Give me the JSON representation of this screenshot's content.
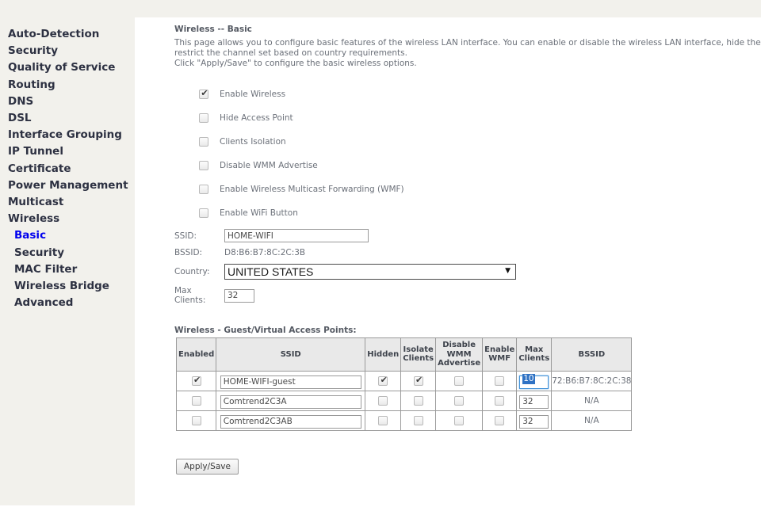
{
  "sidebar": {
    "items": [
      {
        "label": "Auto-Detection",
        "sub": false,
        "active": false
      },
      {
        "label": "Security",
        "sub": false,
        "active": false
      },
      {
        "label": "Quality of Service",
        "sub": false,
        "active": false
      },
      {
        "label": "Routing",
        "sub": false,
        "active": false
      },
      {
        "label": "DNS",
        "sub": false,
        "active": false
      },
      {
        "label": "DSL",
        "sub": false,
        "active": false
      },
      {
        "label": "Interface Grouping",
        "sub": false,
        "active": false
      },
      {
        "label": "IP Tunnel",
        "sub": false,
        "active": false
      },
      {
        "label": "Certificate",
        "sub": false,
        "active": false
      },
      {
        "label": "Power Management",
        "sub": false,
        "active": false
      },
      {
        "label": "Multicast",
        "sub": false,
        "active": false
      },
      {
        "label": "Wireless",
        "sub": false,
        "active": false
      },
      {
        "label": "Basic",
        "sub": true,
        "active": true
      },
      {
        "label": "Security",
        "sub": true,
        "active": false
      },
      {
        "label": "MAC Filter",
        "sub": true,
        "active": false
      },
      {
        "label": "Wireless Bridge",
        "sub": true,
        "active": false
      },
      {
        "label": "Advanced",
        "sub": true,
        "active": false
      }
    ]
  },
  "main": {
    "title": "Wireless -- Basic",
    "description_line1": "This page allows you to configure basic features of the wireless LAN interface. You can enable or disable the wireless LAN interface, hide the network from active scans,",
    "description_line2": "restrict the channel set based on country requirements.",
    "description_line3": "Click \"Apply/Save\" to configure the basic wireless options.",
    "checkboxes": [
      {
        "label": "Enable Wireless",
        "checked": true
      },
      {
        "label": "Hide Access Point",
        "checked": false
      },
      {
        "label": "Clients Isolation",
        "checked": false
      },
      {
        "label": "Disable WMM Advertise",
        "checked": false
      },
      {
        "label": "Enable Wireless Multicast Forwarding (WMF)",
        "checked": false
      },
      {
        "label": "Enable WiFi Button",
        "checked": false
      }
    ],
    "fields": {
      "ssid_label": "SSID:",
      "ssid_value": "HOME-WIFI",
      "bssid_label": "BSSID:",
      "bssid_value": "D8:B6:B7:8C:2C:3B",
      "country_label": "Country:",
      "country_value": "UNITED STATES",
      "max_clients_label": "Max Clients:",
      "max_clients_value": "32"
    },
    "guest_table": {
      "title": "Wireless - Guest/Virtual Access Points:",
      "headers": {
        "enabled": "Enabled",
        "ssid": "SSID",
        "hidden": "Hidden",
        "isolate_clients": "Isolate\nClients",
        "isolate_clients_l1": "Isolate",
        "isolate_clients_l2": "Clients",
        "disable_wmm_l1": "Disable",
        "disable_wmm_l2": "WMM",
        "disable_wmm_l3": "Advertise",
        "enable_wmf_l1": "Enable",
        "enable_wmf_l2": "WMF",
        "max_clients_l1": "Max",
        "max_clients_l2": "Clients",
        "bssid": "BSSID"
      },
      "rows": [
        {
          "enabled": true,
          "ssid": "HOME-WIFI-guest",
          "hidden": true,
          "isolate_clients": true,
          "disable_wmm": false,
          "enable_wmf": false,
          "max_clients": "10",
          "max_clients_focused": true,
          "bssid": "72:B6:B7:8C:2C:38"
        },
        {
          "enabled": false,
          "ssid": "Comtrend2C3A",
          "hidden": false,
          "isolate_clients": false,
          "disable_wmm": false,
          "enable_wmf": false,
          "max_clients": "32",
          "max_clients_focused": false,
          "bssid": "N/A"
        },
        {
          "enabled": false,
          "ssid": "Comtrend2C3AB",
          "hidden": false,
          "isolate_clients": false,
          "disable_wmm": false,
          "enable_wmf": false,
          "max_clients": "32",
          "max_clients_focused": false,
          "bssid": "N/A"
        }
      ]
    },
    "apply_button": "Apply/Save"
  },
  "colors": {
    "sidebar_bg": "#f2f1ec",
    "nav_text": "#2d3142",
    "nav_active": "#0000ee",
    "body_text": "#6b7079",
    "table_header_bg": "#e9e9e9",
    "focus_blue": "#3d8fd8",
    "selection_blue": "#2f72c4"
  }
}
